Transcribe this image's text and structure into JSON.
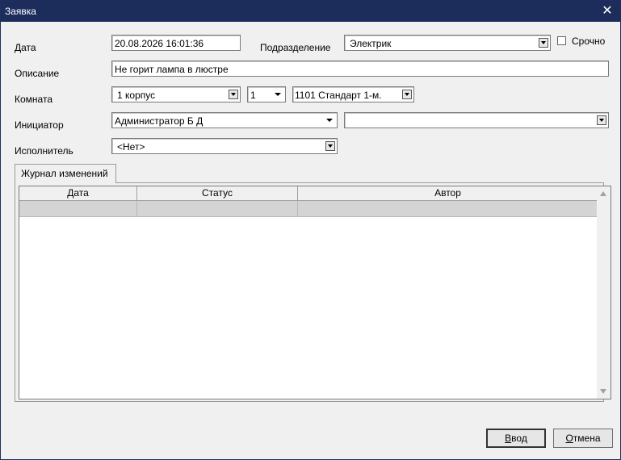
{
  "window": {
    "title": "Заявка",
    "close_glyph": "✕"
  },
  "form": {
    "date": {
      "label": "Дата",
      "value": "20.08.2026 16:01:36"
    },
    "department": {
      "label": "Подразделение",
      "value": "Электрик"
    },
    "urgent": {
      "label": "Срочно",
      "checked": false
    },
    "description": {
      "label": "Описание",
      "value": "Не горит лампа в люстре"
    },
    "room": {
      "label": "Комната",
      "building": "1 корпус",
      "floor": "1",
      "room": "1101  Стандарт 1-м."
    },
    "initiator": {
      "label": "Инициатор",
      "value": "Администратор Б Д",
      "extra": ""
    },
    "executor": {
      "label": "Исполнитель",
      "value": "<Нет>"
    }
  },
  "tabs": [
    {
      "label": "Журнал изменений",
      "active": true
    }
  ],
  "table": {
    "columns": [
      "Дата",
      "Статус",
      "Автор"
    ],
    "rows": [
      [
        "",
        "",
        ""
      ]
    ]
  },
  "buttons": {
    "ok": {
      "hotkey": "В",
      "rest": "вод"
    },
    "cancel": {
      "hotkey": "О",
      "rest": "тмена"
    }
  },
  "icons": {
    "close": "close-icon",
    "dropdown": "dropdown-arrow-icon",
    "scroll_up": "scroll-up-icon",
    "scroll_down": "scroll-down-icon"
  }
}
